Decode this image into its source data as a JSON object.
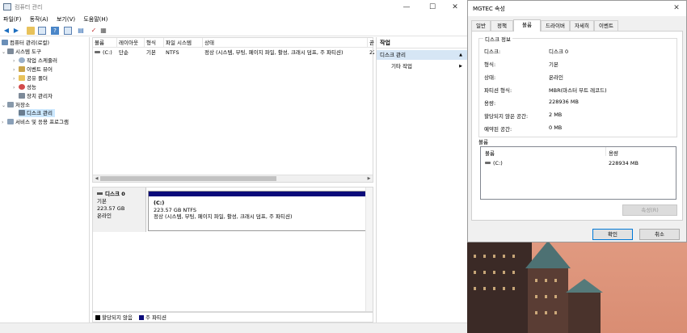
{
  "main_window": {
    "title": "컴퓨터 관리",
    "controls": {
      "minimize": "—",
      "maximize": "☐",
      "close": "✕"
    },
    "menu": [
      "파일(F)",
      "동작(A)",
      "보기(V)",
      "도움말(H)"
    ],
    "tree": {
      "root": "컴퓨터 관리(로컬)",
      "system_tools": "시스템 도구",
      "task_scheduler": "작업 스케줄러",
      "event_viewer": "이벤트 뷰어",
      "shared_folders": "공유 폴더",
      "performance": "성능",
      "device_manager": "장치 관리자",
      "storage": "저장소",
      "disk_management": "디스크 관리",
      "services_apps": "서비스 및 응용 프로그램"
    },
    "volume_table": {
      "headers": [
        "볼륨",
        "레이아웃",
        "형식",
        "파일 시스템",
        "상태",
        "곧"
      ],
      "row": {
        "volume": "(C:)",
        "layout": "단순",
        "type": "기본",
        "fs": "NTFS",
        "status": "정상 (시스템, 부팅, 페이지 파일, 활성, 크래시 덤프, 주 파티션)",
        "extra": "22"
      }
    },
    "disk": {
      "name": "디스크 0",
      "type": "기본",
      "size": "223.57 GB",
      "state": "온라인",
      "partition": {
        "label": "(C:)",
        "size_fs": "223.57 GB NTFS",
        "status": "정상 (시스템, 부팅, 페이지 파일, 활성, 크래시 덤프, 주 파티션)"
      }
    },
    "legend": {
      "unallocated": "할당되지 않음",
      "primary": "주 파티션"
    },
    "actions": {
      "header": "작업",
      "selected": "디스크 관리",
      "more": "기타 작업"
    }
  },
  "dialog": {
    "title": "MGTEC 속성",
    "tabs": [
      "일반",
      "정책",
      "볼륨",
      "드라이버",
      "자세히",
      "이벤트"
    ],
    "active_tab": "볼륨",
    "group_title": "디스크 정보",
    "fields": [
      {
        "label": "디스크:",
        "value": "디스크 0"
      },
      {
        "label": "형식:",
        "value": "기본"
      },
      {
        "label": "상태:",
        "value": "온라인"
      },
      {
        "label": "파티션 형식:",
        "value": "MBR(마스터 부트 레코드)"
      },
      {
        "label": "용량:",
        "value": "228936 MB"
      },
      {
        "label": "할당되지 않은 공간:",
        "value": "2 MB"
      },
      {
        "label": "예약된 공간:",
        "value": "0 MB"
      }
    ],
    "volumes_label": "볼륨",
    "volumes_headers": {
      "volume": "볼륨",
      "capacity": "용량"
    },
    "volumes_rows": [
      {
        "volume": "(C:)",
        "capacity": "228934 MB"
      }
    ],
    "properties_button": "속성(R)",
    "ok_button": "확인",
    "cancel_button": "취소",
    "close": "✕"
  },
  "colors": {
    "primary_partition": "#0b0b7a",
    "unallocated": "#000000",
    "selection": "#cce8ff",
    "accent": "#0078d7"
  }
}
